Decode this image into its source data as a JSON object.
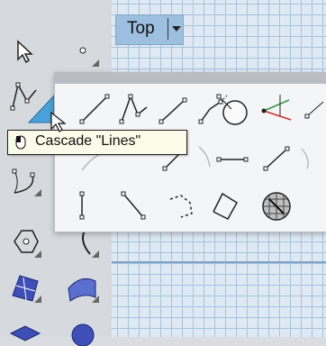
{
  "viewport": {
    "name": "Top"
  },
  "tooltip": {
    "text": "Cascade \"Lines\""
  },
  "colors": {
    "accent": "#9ec0e0",
    "grid": "#a7c3dc",
    "tooltip_bg": "#fbfbe9",
    "flyout_bg": "#f4f5f7"
  },
  "toolbar_icons": [
    "select-arrow-icon",
    "point-icon",
    "polyline-icon",
    "line-icon-selected",
    "arc-icon",
    "ellipse-icon",
    "polygon-icon",
    "curve-icon",
    "surface-icon",
    "loft-surface-icon",
    "box-icon",
    "sphere-icon"
  ],
  "flyout_icons": [
    "line-segments-icon",
    "line-icon",
    "polyline-open-icon",
    "polyline-extended-icon",
    "sphere-point-icon",
    "axes-icon",
    "curve-through-points-icon",
    "line-with-sphere-icon",
    "dashed-curve-icon",
    "two-point-line-icon",
    "line-normal-icon",
    "line-extend-icon",
    "single-line-icon",
    "diagonal-line-icon",
    "dashed-polyline-icon",
    "polygon-outline-icon",
    "wire-sphere-icon"
  ]
}
